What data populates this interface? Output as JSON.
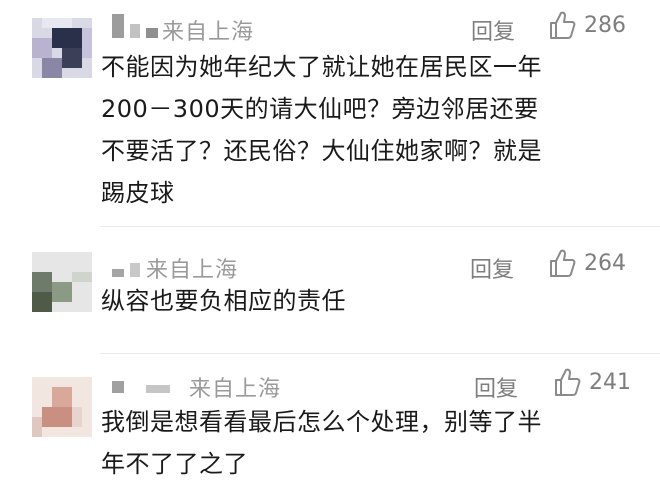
{
  "comments": [
    {
      "location": "来自上海",
      "reply_label": "回复",
      "likes": "286",
      "lines": [
        "不能因为她年纪大了就让她在居民区一年",
        "200－300天的请大仙吧？旁边邻居还要",
        "不要活了？还民俗？大仙住她家啊？就是",
        "踢皮球"
      ]
    },
    {
      "location": "来自上海",
      "reply_label": "回复",
      "likes": "264",
      "lines": [
        "纵容也要负相应的责任"
      ]
    },
    {
      "location": "来自上海",
      "reply_label": "回复",
      "likes": "241",
      "lines": [
        "我倒是想看看最后怎么个处理，别等了半",
        "年不了了之了"
      ]
    }
  ]
}
